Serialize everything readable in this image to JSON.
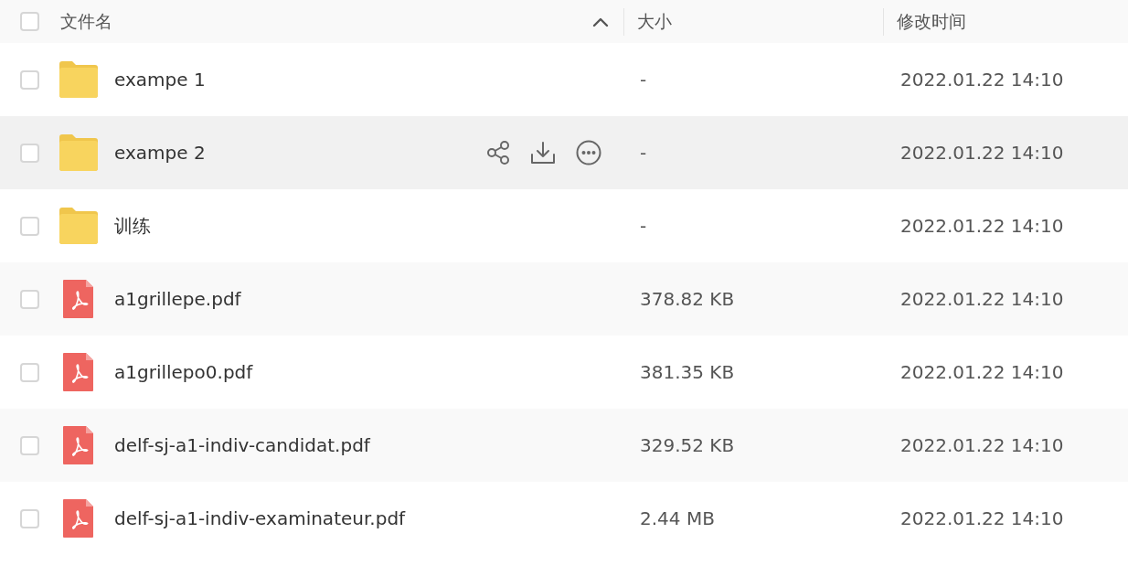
{
  "table": {
    "select_all": {
      "checked": false
    },
    "columns": [
      {
        "label": "文件名",
        "sort_ascending": true
      },
      {
        "label": "大小"
      },
      {
        "label": "修改时间"
      }
    ],
    "rows": [
      {
        "kind": "folder",
        "name": "exampe 1",
        "size": "-",
        "modified": "2022.01.22 14:10",
        "checked": false,
        "hovered": false
      },
      {
        "kind": "folder",
        "name": "exampe 2",
        "size": "-",
        "modified": "2022.01.22 14:10",
        "checked": false,
        "hovered": true
      },
      {
        "kind": "folder",
        "name": "训练",
        "size": "-",
        "modified": "2022.01.22 14:10",
        "checked": false,
        "hovered": false
      },
      {
        "kind": "pdf",
        "name": "a1grillepe.pdf",
        "size": "378.82 KB",
        "modified": "2022.01.22 14:10",
        "checked": false,
        "hovered": false
      },
      {
        "kind": "pdf",
        "name": "a1grillepo0.pdf",
        "size": "381.35 KB",
        "modified": "2022.01.22 14:10",
        "checked": false,
        "hovered": false
      },
      {
        "kind": "pdf",
        "name": "delf-sj-a1-indiv-candidat.pdf",
        "size": "329.52 KB",
        "modified": "2022.01.22 14:10",
        "checked": false,
        "hovered": false
      },
      {
        "kind": "pdf",
        "name": "delf-sj-a1-indiv-examinateur.pdf",
        "size": "2.44 MB",
        "modified": "2022.01.22 14:10",
        "checked": false,
        "hovered": false
      }
    ]
  }
}
